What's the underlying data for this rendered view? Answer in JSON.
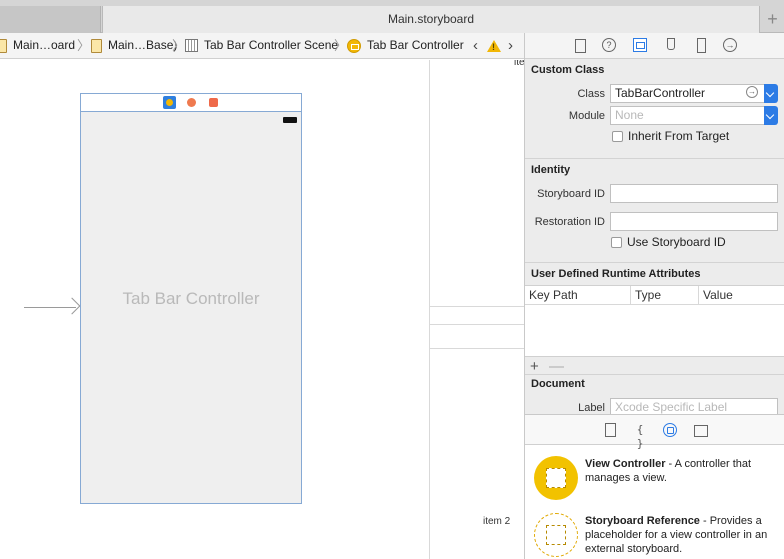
{
  "window": {
    "tab_title": "Main.storyboard",
    "new_tab_label": "+"
  },
  "jumpbar": {
    "crumbs": [
      {
        "label": "Main…oard"
      },
      {
        "label": "Main…Base)"
      },
      {
        "label": "Tab Bar Controller Scene"
      },
      {
        "label": "Tab Bar Controller"
      }
    ],
    "separator": "〉",
    "back_label": "‹",
    "forward_label": "›"
  },
  "canvas": {
    "scene_label": "Tab Bar Controller",
    "item_top_label": "ite",
    "item_2_label": "item 2"
  },
  "inspector": {
    "custom_class": {
      "title": "Custom Class",
      "class_label": "Class",
      "class_value": "TabBarController",
      "module_label": "Module",
      "module_placeholder": "None",
      "inherit_label": "Inherit From Target",
      "inherit_checked": false
    },
    "identity": {
      "title": "Identity",
      "storyboard_id_label": "Storyboard ID",
      "storyboard_id_value": "",
      "restoration_id_label": "Restoration ID",
      "restoration_id_value": "",
      "use_storyboard_id_label": "Use Storyboard ID",
      "use_storyboard_id_checked": false
    },
    "runtime_attributes": {
      "title": "User Defined Runtime Attributes",
      "columns": [
        "Key Path",
        "Type",
        "Value"
      ],
      "rows": [],
      "add_label": "+",
      "remove_label": "—"
    },
    "document": {
      "title": "Document",
      "label_label": "Label",
      "label_placeholder": "Xcode Specific Label"
    }
  },
  "library": {
    "items": [
      {
        "name": "View Controller",
        "description": " - A controller that manages a view.",
        "icon": "view-controller-icon",
        "style": "filled"
      },
      {
        "name": "Storyboard Reference",
        "description": " - Provides a placeholder for a view controller in an external storyboard.",
        "icon": "storyboard-reference-icon",
        "style": "outlined"
      }
    ]
  },
  "colors": {
    "accent": "#2c7be5",
    "controller_yellow": "#f2b705"
  }
}
